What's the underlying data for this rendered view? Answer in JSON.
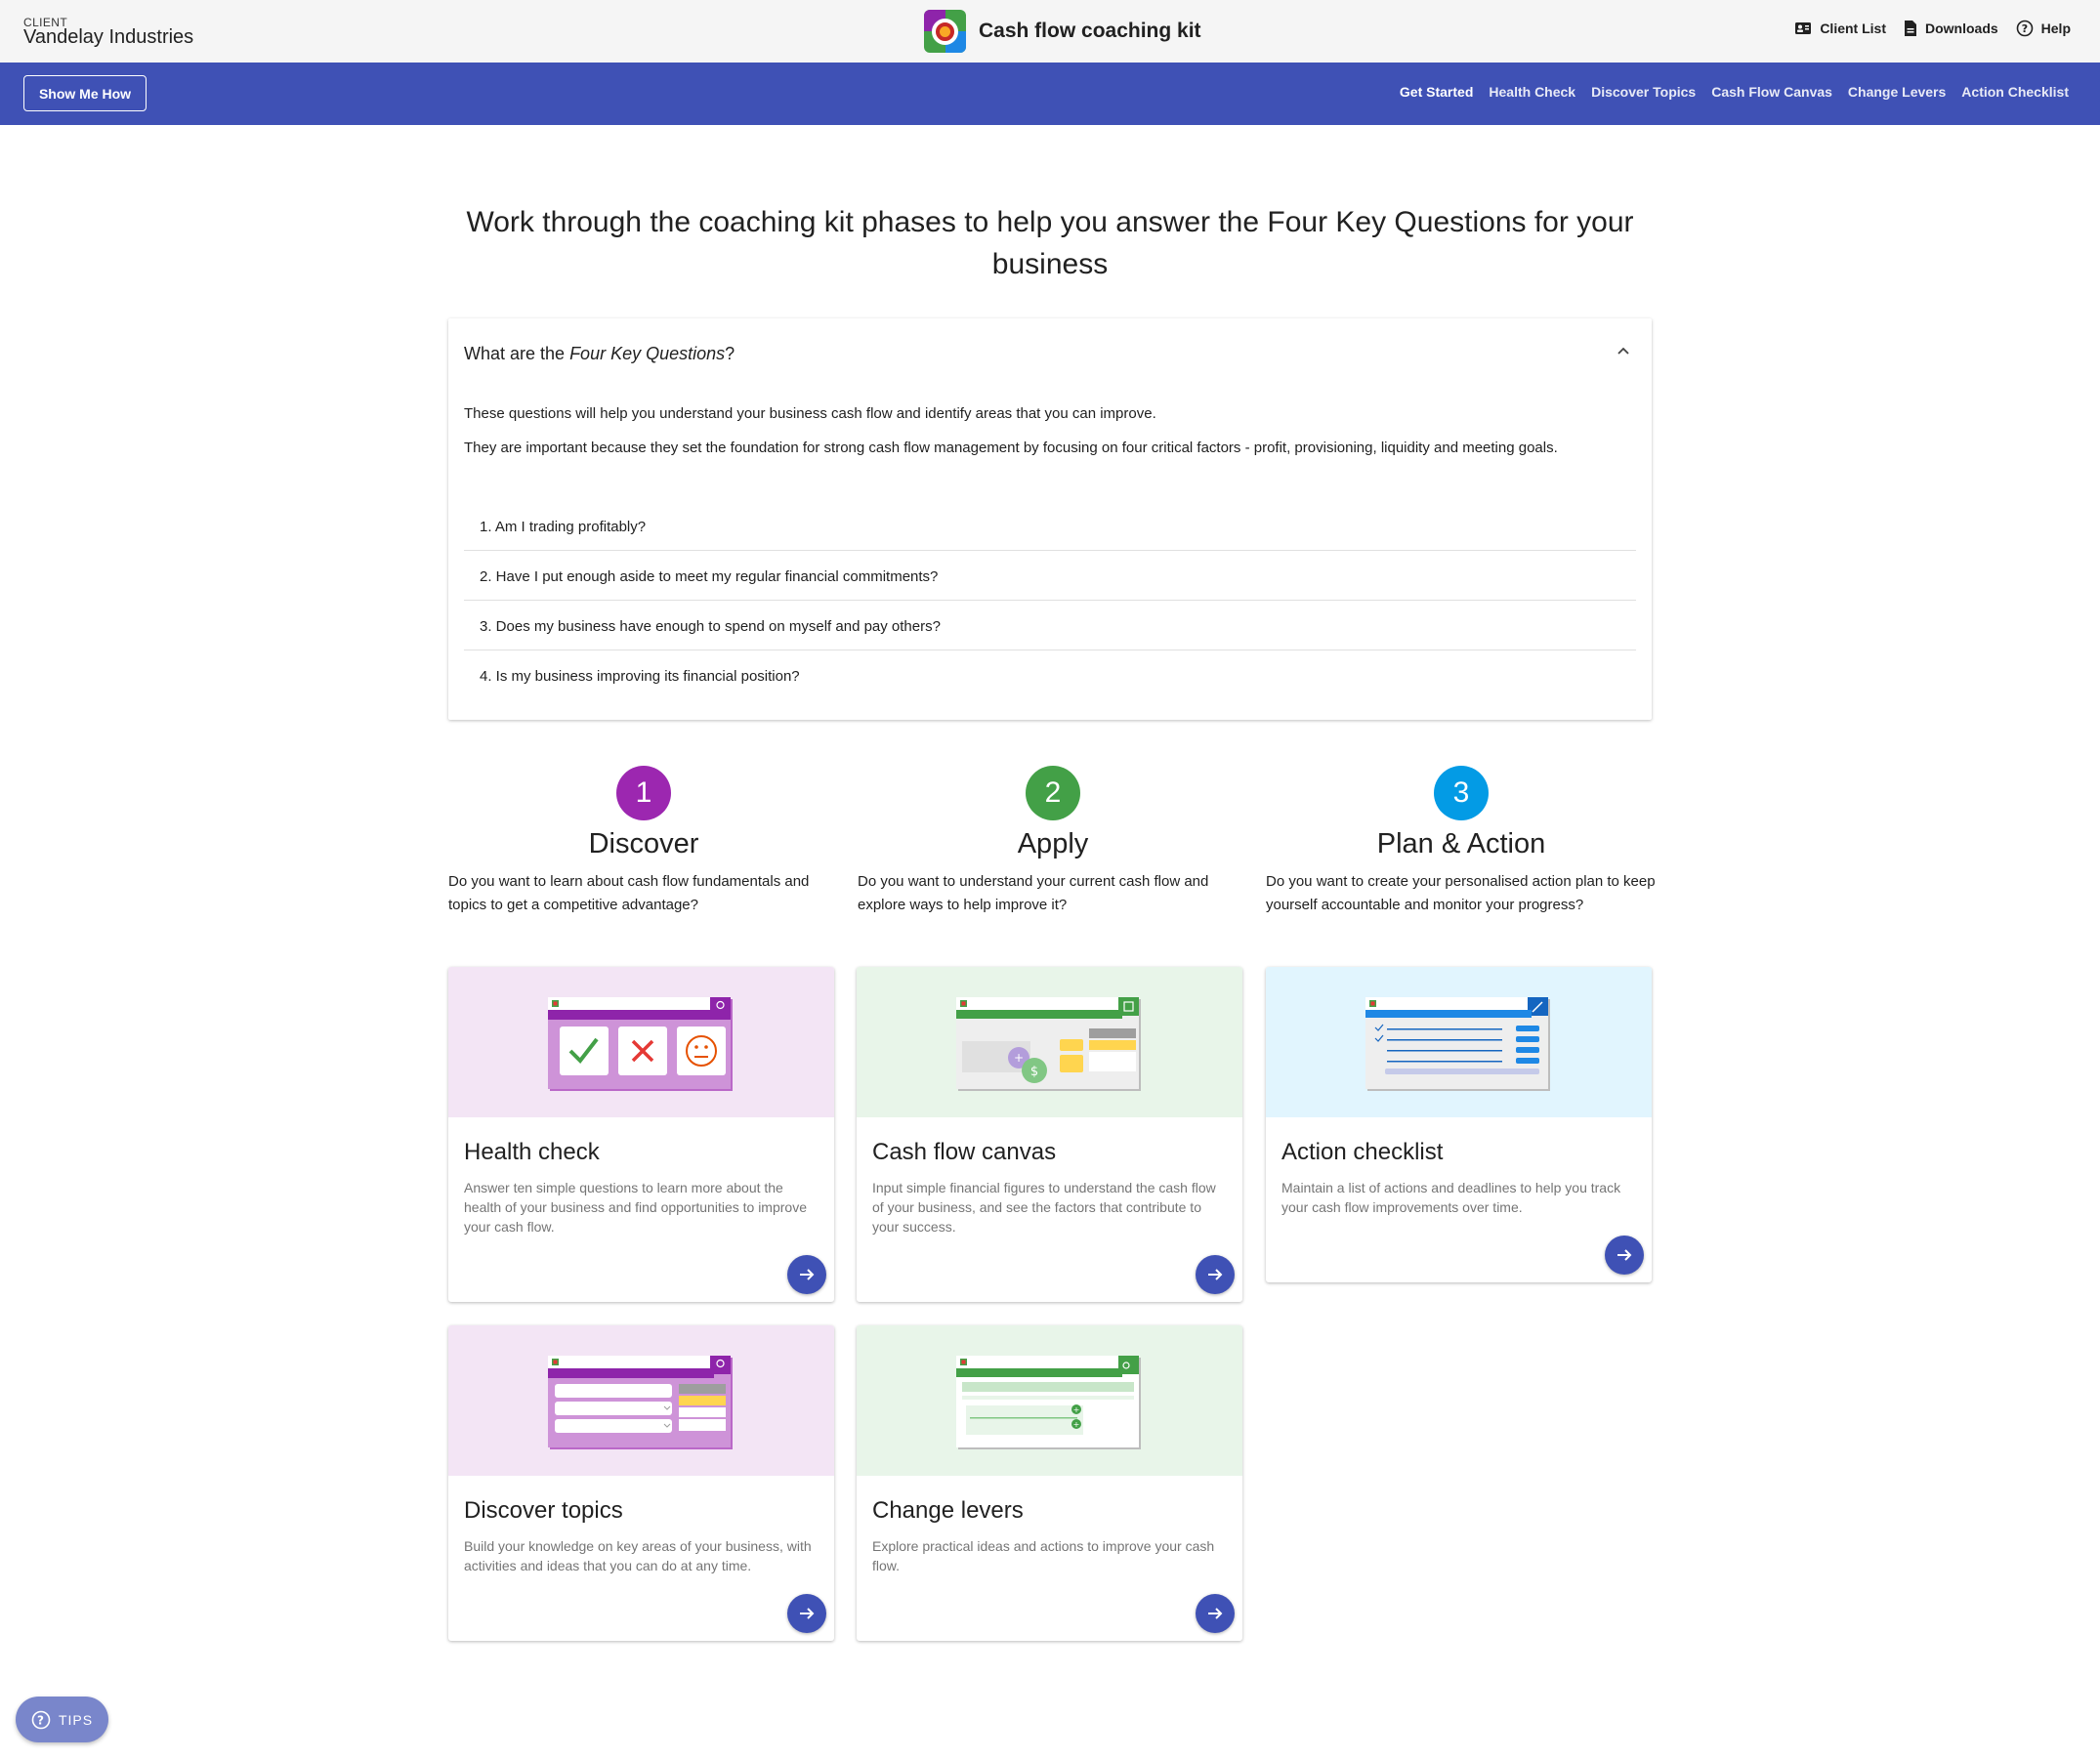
{
  "header": {
    "client_label": "CLIENT",
    "client_name": "Vandelay Industries",
    "app_title": "Cash flow coaching kit",
    "actions": {
      "client_list": "Client List",
      "downloads": "Downloads",
      "help": "Help"
    }
  },
  "navbar": {
    "show_me_how": "Show Me How",
    "links": [
      "Get Started",
      "Health Check",
      "Discover Topics",
      "Cash Flow Canvas",
      "Change Levers",
      "Action Checklist"
    ],
    "active": "Get Started"
  },
  "main": {
    "heading": "Work through the coaching kit phases to help you answer the Four Key Questions for your business"
  },
  "accordion": {
    "title_prefix": "What are the ",
    "title_emph": "Four Key Questions",
    "title_suffix": "?",
    "expanded": true,
    "para1": "These questions will help you understand your business cash flow and identify areas that you can improve.",
    "para2": "They are important because they set the foundation for strong cash flow management by focusing on four critical factors - profit, provisioning, liquidity and meeting goals.",
    "questions": [
      "1. Am I trading profitably?",
      "2. Have I put enough aside to meet my regular financial commitments?",
      "3. Does my business have enough to spend on myself and pay others?",
      "4. Is my business improving its financial position?"
    ]
  },
  "phases": [
    {
      "number": "1",
      "title": "Discover",
      "description": "Do you want to learn about cash flow fundamentals and topics to get a competitive advantage?",
      "color": "#9c27b0"
    },
    {
      "number": "2",
      "title": "Apply",
      "description": "Do you want to understand your current cash flow and explore ways to help improve it?",
      "color": "#43a047"
    },
    {
      "number": "3",
      "title": "Plan & Action",
      "description": "Do you want to create your personalised action plan to keep yourself accountable and monitor your progress?",
      "color": "#039be5"
    }
  ],
  "cards": {
    "health_check": {
      "title": "Health check",
      "description": "Answer ten simple questions to learn more about the health of your business and find opportunities to improve your cash flow.",
      "bg": "#f3e5f5"
    },
    "cash_flow_canvas": {
      "title": "Cash flow canvas",
      "description": "Input simple financial figures to understand the cash flow of your business, and see the factors that contribute to your success.",
      "bg": "#e8f5e9"
    },
    "action_checklist": {
      "title": "Action checklist",
      "description": "Maintain a list of actions and deadlines to help you track your cash flow improvements over time.",
      "bg": "#e1f5fe"
    },
    "discover_topics": {
      "title": "Discover topics",
      "description": "Build your knowledge on key areas of your business, with activities and ideas that you can do at any time.",
      "bg": "#f3e5f5"
    },
    "change_levers": {
      "title": "Change levers",
      "description": "Explore practical ideas and actions to improve your cash flow.",
      "bg": "#e8f5e9"
    }
  },
  "tips": {
    "label": "TIPS"
  },
  "colors": {
    "primary": "#3f51b5",
    "tips": "#7986cb"
  }
}
